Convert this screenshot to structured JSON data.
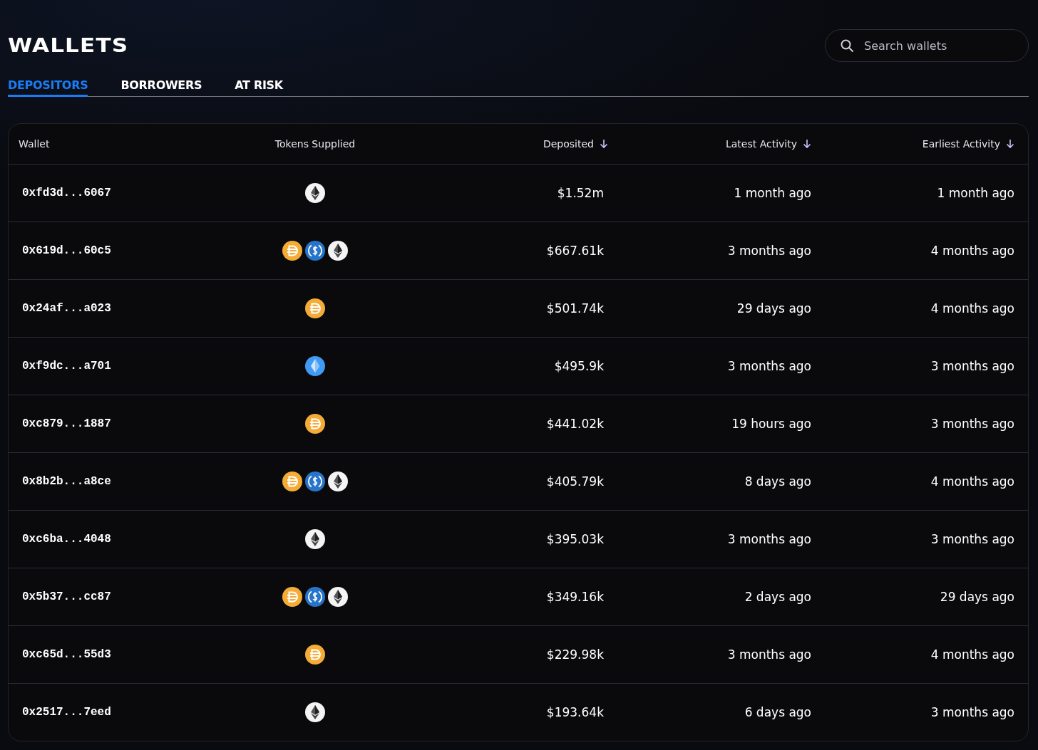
{
  "title": "WALLETS",
  "search": {
    "placeholder": "Search wallets"
  },
  "tabs": [
    {
      "label": "DEPOSITORS",
      "selected": true
    },
    {
      "label": "BORROWERS",
      "selected": false
    },
    {
      "label": "AT RISK",
      "selected": false
    }
  ],
  "table": {
    "columns": [
      {
        "label": "Wallet",
        "sorted": false
      },
      {
        "label": "Tokens Supplied",
        "sorted": false
      },
      {
        "label": "Deposited",
        "sorted": true
      },
      {
        "label": "Latest Activity",
        "sorted": true
      },
      {
        "label": "Earliest Activity",
        "sorted": true
      }
    ],
    "rows": [
      {
        "wallet": "0xfd3d...6067",
        "tokens": [
          {
            "kind": "eth"
          }
        ],
        "deposited": "$1.52m",
        "latest": "1 month ago",
        "earliest": "1 month ago"
      },
      {
        "wallet": "0x619d...60c5",
        "tokens": [
          {
            "kind": "dai"
          },
          {
            "kind": "usdc"
          },
          {
            "kind": "eth"
          }
        ],
        "deposited": "$667.61k",
        "latest": "3 months ago",
        "earliest": "4 months ago"
      },
      {
        "wallet": "0x24af...a023",
        "tokens": [
          {
            "kind": "dai"
          }
        ],
        "deposited": "$501.74k",
        "latest": "29 days ago",
        "earliest": "4 months ago"
      },
      {
        "wallet": "0xf9dc...a701",
        "tokens": [
          {
            "kind": "eth_blue"
          }
        ],
        "deposited": "$495.9k",
        "latest": "3 months ago",
        "earliest": "3 months ago"
      },
      {
        "wallet": "0xc879...1887",
        "tokens": [
          {
            "kind": "dai"
          }
        ],
        "deposited": "$441.02k",
        "latest": "19 hours ago",
        "earliest": "3 months ago"
      },
      {
        "wallet": "0x8b2b...a8ce",
        "tokens": [
          {
            "kind": "dai"
          },
          {
            "kind": "usdc"
          },
          {
            "kind": "eth"
          }
        ],
        "deposited": "$405.79k",
        "latest": "8 days ago",
        "earliest": "4 months ago"
      },
      {
        "wallet": "0xc6ba...4048",
        "tokens": [
          {
            "kind": "eth"
          }
        ],
        "deposited": "$395.03k",
        "latest": "3 months ago",
        "earliest": "3 months ago"
      },
      {
        "wallet": "0x5b37...cc87",
        "tokens": [
          {
            "kind": "dai"
          },
          {
            "kind": "usdc"
          },
          {
            "kind": "eth"
          }
        ],
        "deposited": "$349.16k",
        "latest": "2 days ago",
        "earliest": "29 days ago"
      },
      {
        "wallet": "0xc65d...55d3",
        "tokens": [
          {
            "kind": "dai"
          }
        ],
        "deposited": "$229.98k",
        "latest": "3 months ago",
        "earliest": "4 months ago"
      },
      {
        "wallet": "0x2517...7eed",
        "tokens": [
          {
            "kind": "eth"
          }
        ],
        "deposited": "$193.64k",
        "latest": "6 days ago",
        "earliest": "3 months ago"
      }
    ]
  }
}
